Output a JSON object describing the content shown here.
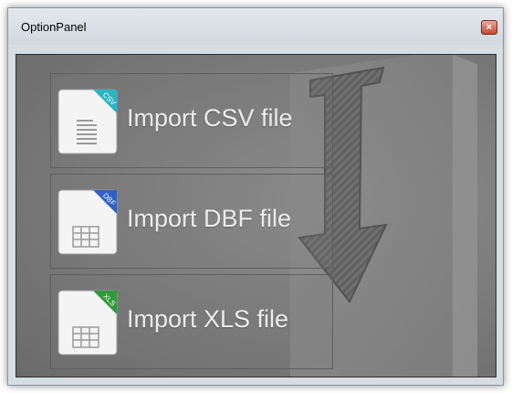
{
  "window": {
    "title": "OptionPanel",
    "close_glyph": "×"
  },
  "buttons": [
    {
      "label": "Import CSV file",
      "badge": "CSV",
      "badge_color": "#2ab5c5",
      "icon": "csv-file-icon"
    },
    {
      "label": "Import DBF file",
      "badge": "DBF",
      "badge_color": "#2f5fc8",
      "icon": "dbf-file-icon"
    },
    {
      "label": "Import XLS file",
      "badge": "XLS",
      "badge_color": "#2f9a3c",
      "icon": "xls-file-icon"
    }
  ],
  "background_icon": "import-arrow-icon"
}
